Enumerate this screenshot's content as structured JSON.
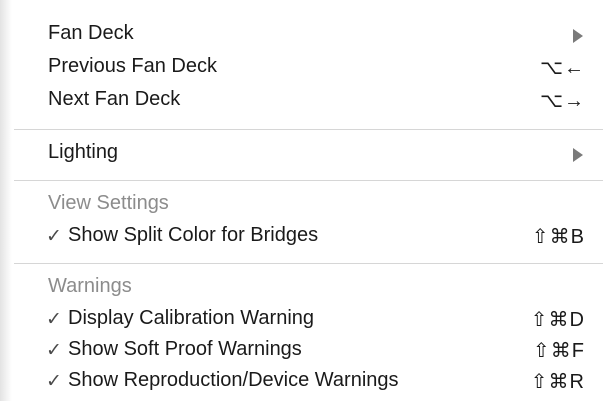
{
  "menu": {
    "fan_deck": {
      "label": "Fan Deck",
      "has_submenu": true,
      "arrow_icon": "submenu-arrow-icon"
    },
    "previous_fan_deck": {
      "label": "Previous Fan Deck",
      "shortcut": "⌥←"
    },
    "next_fan_deck": {
      "label": "Next Fan Deck",
      "shortcut": "⌥→"
    },
    "lighting": {
      "label": "Lighting",
      "has_submenu": true,
      "arrow_icon": "submenu-arrow-icon"
    },
    "view_settings_header": "View Settings",
    "show_split_color": {
      "checkmark": "✓",
      "label": "Show Split Color for Bridges",
      "shortcut": "⇧⌘B",
      "checked": true
    },
    "warnings_header": "Warnings",
    "display_calibration": {
      "checkmark": "✓",
      "label": "Display Calibration Warning",
      "shortcut": "⇧⌘D",
      "checked": true
    },
    "soft_proof": {
      "checkmark": "✓",
      "label": "Show Soft Proof Warnings",
      "shortcut": "⇧⌘F",
      "checked": true
    },
    "reproduction": {
      "checkmark": "✓",
      "label": "Show Reproduction/Device Warnings",
      "shortcut": "⇧⌘R",
      "checked": true
    }
  },
  "colors": {
    "menu_background": "#ffffff",
    "text": "#1a1a1a",
    "disabled_header": "#8c8c8c",
    "separator": "#d6d6d6",
    "submenu_arrow": "#7a7a7a"
  }
}
